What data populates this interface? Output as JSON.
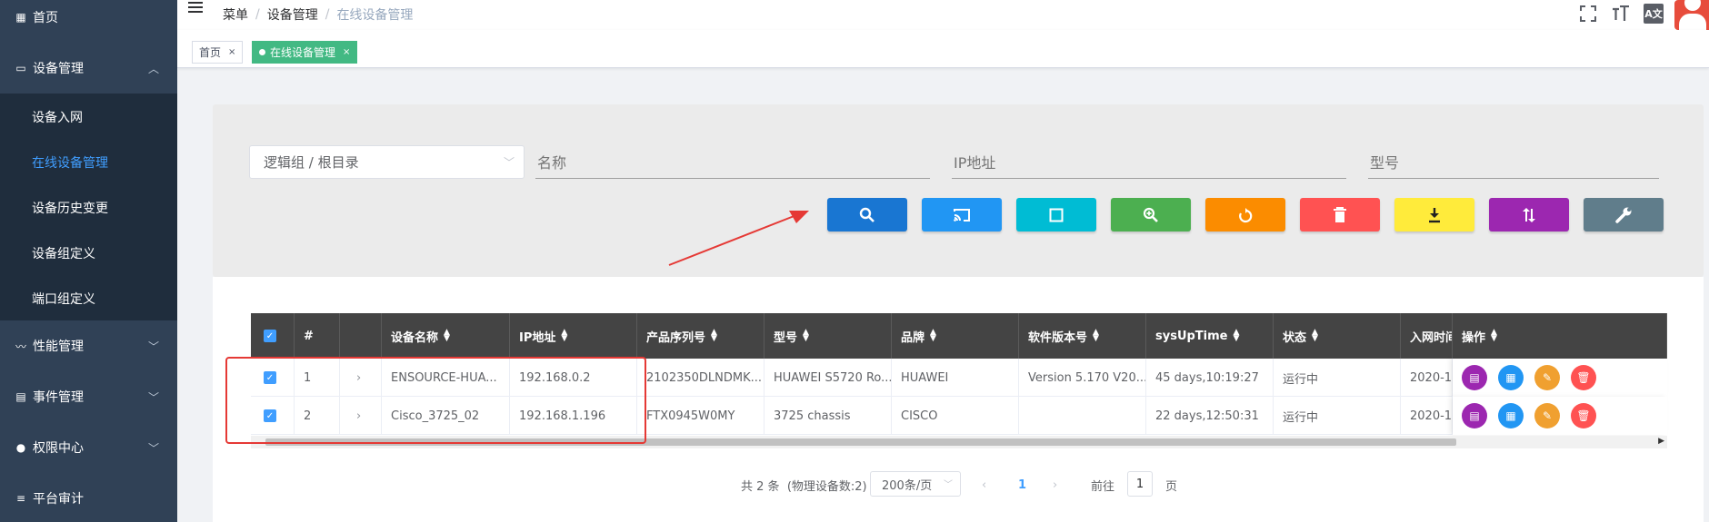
{
  "sidebar": {
    "items": [
      {
        "label": "首页",
        "icon": "dashboard-icon"
      },
      {
        "label": "设备管理",
        "icon": "laptop-icon",
        "expanded": true
      },
      {
        "label": "性能管理",
        "icon": "chart-line-icon"
      },
      {
        "label": "事件管理",
        "icon": "calendar-icon"
      },
      {
        "label": "权限中心",
        "icon": "user-icon"
      },
      {
        "label": "平台审计",
        "icon": "list-icon"
      }
    ],
    "subitems": [
      "设备入网",
      "在线设备管理",
      "设备历史变更",
      "设备组定义",
      "端口组定义"
    ],
    "active_subitem": "在线设备管理"
  },
  "header": {
    "breadcrumb": [
      "菜单",
      "设备管理",
      "在线设备管理"
    ],
    "icons": [
      "fullscreen-icon",
      "font-size-icon",
      "translate-icon",
      "avatar-icon"
    ],
    "translate_glyph": "A文"
  },
  "tags": [
    {
      "label": "首页",
      "active": false
    },
    {
      "label": "在线设备管理",
      "active": true
    }
  ],
  "filters": {
    "group_select": "逻辑组 / 根目录",
    "name_placeholder": "名称",
    "ip_placeholder": "IP地址",
    "model_placeholder": "型号"
  },
  "toolbar": [
    {
      "icon": "search-icon",
      "color": "#1976d2"
    },
    {
      "icon": "cast-icon",
      "color": "#2196f3"
    },
    {
      "icon": "square-icon",
      "color": "#00bcd4"
    },
    {
      "icon": "zoom-in-icon",
      "color": "#4caf50"
    },
    {
      "icon": "refresh-icon",
      "color": "#fb8c00"
    },
    {
      "icon": "delete-icon",
      "color": "#ff5252"
    },
    {
      "icon": "download-icon",
      "color": "#ffeb3b"
    },
    {
      "icon": "swap-vertical-icon",
      "color": "#9c27b0"
    },
    {
      "icon": "wrench-icon",
      "color": "#607d8b"
    }
  ],
  "table": {
    "headers": [
      "#",
      "设备名称",
      "IP地址",
      "产品序列号",
      "型号",
      "品牌",
      "软件版本号",
      "sysUpTime",
      "状态",
      "入网时间",
      "操作"
    ],
    "rows": [
      {
        "index": "1",
        "name": "ENSOURCE-HUA...",
        "ip": "192.168.0.2",
        "serial": "2102350DLNDMK...",
        "model": "HUAWEI S5720 Ro...",
        "brand": "HUAWEI",
        "version": "Version 5.170 V20...",
        "uptime": "45 days,10:19:27",
        "status": "运行中",
        "join_time": "2020-1"
      },
      {
        "index": "2",
        "name": "Cisco_3725_02",
        "ip": "192.168.1.196",
        "serial": "FTX0945W0MY",
        "model": "3725 chassis",
        "brand": "CISCO",
        "version": "",
        "uptime": "22 days,12:50:31",
        "status": "运行中",
        "join_time": "2020-1"
      }
    ],
    "row_actions": [
      {
        "icon": "document-icon",
        "color": "#9c27b0"
      },
      {
        "icon": "grid-icon",
        "color": "#2196f3"
      },
      {
        "icon": "edit-icon",
        "color": "#f0a030"
      },
      {
        "icon": "trash-icon",
        "color": "#ff5252"
      }
    ]
  },
  "pagination": {
    "total": "共 2 条",
    "physical": "(物理设备数:2)",
    "page_size": "200条/页",
    "current_page": "1",
    "goto_label": "前往",
    "goto_value": "1",
    "page_suffix": "页"
  }
}
